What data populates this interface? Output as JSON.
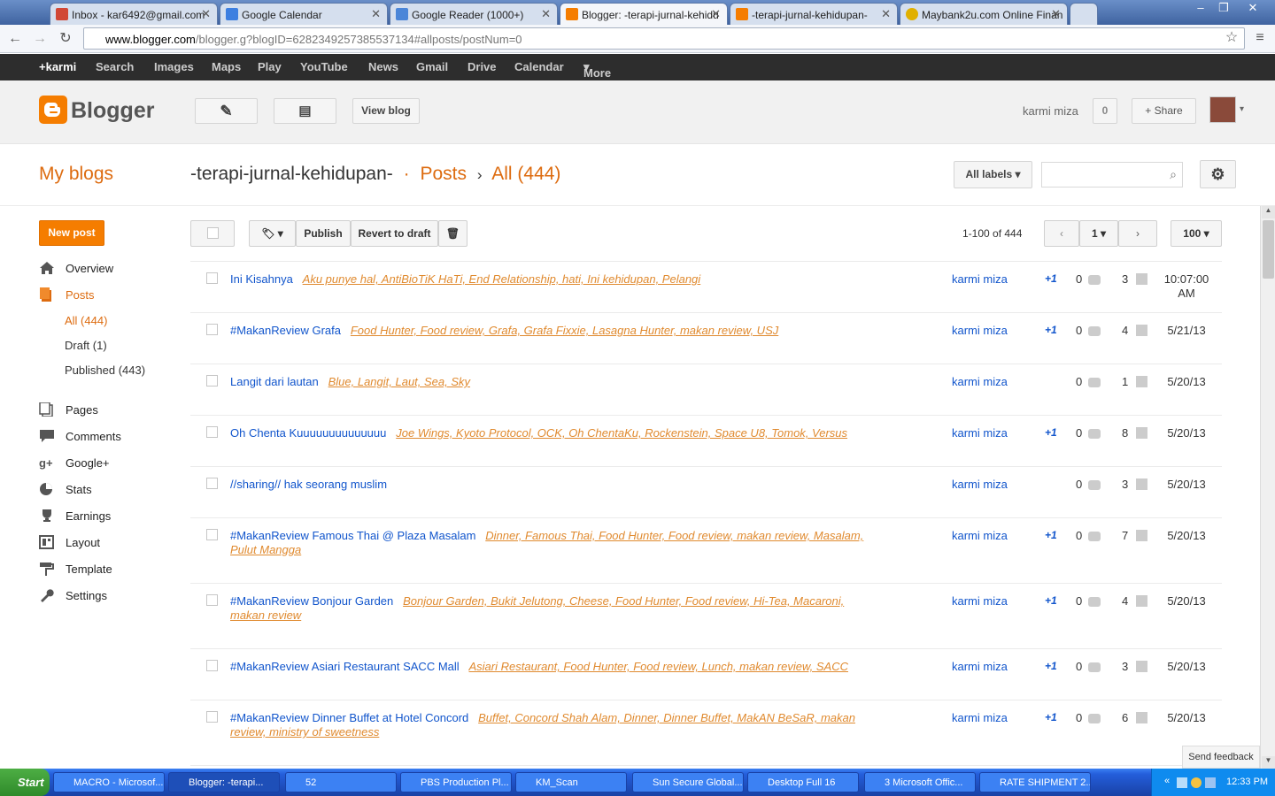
{
  "browser": {
    "tabs": [
      {
        "label": "Inbox - kar6492@gmail.com"
      },
      {
        "label": "Google Calendar"
      },
      {
        "label": "Google Reader (1000+)"
      },
      {
        "label": "Blogger: -terapi-jurnal-kehidu"
      },
      {
        "label": "-terapi-jurnal-kehidupan-"
      },
      {
        "label": "Maybank2u.com Online Finan"
      }
    ],
    "url_host": "www.blogger.com",
    "url_path": "/blogger.g?blogID=6282349257385537134#allposts/postNum=0"
  },
  "gbar": [
    "+karmi",
    "Search",
    "Images",
    "Maps",
    "Play",
    "YouTube",
    "News",
    "Gmail",
    "Drive",
    "Calendar",
    "More"
  ],
  "header": {
    "logo_text": "Blogger",
    "view_blog": "View blog",
    "username": "karmi miza",
    "notif_count": "0",
    "share": "Share"
  },
  "subheader": {
    "my_blogs": "My blogs",
    "blog_name": "-terapi-jurnal-kehidupan-",
    "dot": "·",
    "posts": "Posts",
    "sep": "›",
    "all": "All (444)",
    "labels_dropdown": "All labels"
  },
  "sidebar": {
    "new_post": "New post",
    "items": [
      {
        "label": "Overview"
      },
      {
        "label": "Posts"
      },
      {
        "label": "Pages"
      },
      {
        "label": "Comments"
      },
      {
        "label": "Google+"
      },
      {
        "label": "Stats"
      },
      {
        "label": "Earnings"
      },
      {
        "label": "Layout"
      },
      {
        "label": "Template"
      },
      {
        "label": "Settings"
      }
    ],
    "sub": [
      "All (444)",
      "Draft (1)",
      "Published (443)"
    ]
  },
  "actions": {
    "publish": "Publish",
    "revert": "Revert to draft",
    "range": "1-100 of 444",
    "page": "1",
    "per_page": "100"
  },
  "posts": [
    {
      "title": "Ini Kisahnya",
      "labels": "Aku punye hal, AntiBioTiK HaTi, End Relationship, hati, Ini kehidupan, Pelangi",
      "author": "karmi miza",
      "plus": "+1",
      "comments": "0",
      "views": "3",
      "date": "10:07:00 AM"
    },
    {
      "title": "#MakanReview Grafa",
      "labels": "Food Hunter, Food review, Grafa, Grafa Fixxie, Lasagna Hunter, makan review, USJ",
      "author": "karmi miza",
      "plus": "+1",
      "comments": "0",
      "views": "4",
      "date": "5/21/13"
    },
    {
      "title": "Langit dari lautan",
      "labels": "Blue, Langit, Laut, Sea, Sky",
      "author": "karmi miza",
      "plus": "",
      "comments": "0",
      "views": "1",
      "date": "5/20/13"
    },
    {
      "title": "Oh Chenta Kuuuuuuuuuuuuuu",
      "labels": "Joe Wings, Kyoto Protocol, OCK, Oh ChentaKu, Rockenstein, Space U8, Tomok, Versus",
      "author": "karmi miza",
      "plus": "+1",
      "comments": "0",
      "views": "8",
      "date": "5/20/13"
    },
    {
      "title": "//sharing// hak seorang muslim",
      "labels": "",
      "author": "karmi miza",
      "plus": "",
      "comments": "0",
      "views": "3",
      "date": "5/20/13"
    },
    {
      "title": "#MakanReview Famous Thai @ Plaza Masalam",
      "labels": "Dinner, Famous Thai, Food Hunter, Food review, makan review, Masalam, Pulut Mangga",
      "author": "karmi miza",
      "plus": "+1",
      "comments": "0",
      "views": "7",
      "date": "5/20/13"
    },
    {
      "title": "#MakanReview Bonjour Garden",
      "labels": "Bonjour Garden, Bukit Jelutong, Cheese, Food Hunter, Food review, Hi-Tea, Macaroni, makan review",
      "author": "karmi miza",
      "plus": "+1",
      "comments": "0",
      "views": "4",
      "date": "5/20/13"
    },
    {
      "title": "#MakanReview Asiari Restaurant SACC Mall",
      "labels": "Asiari Restaurant, Food Hunter, Food review, Lunch, makan review, SACC",
      "author": "karmi miza",
      "plus": "+1",
      "comments": "0",
      "views": "3",
      "date": "5/20/13"
    },
    {
      "title": "#MakanReview Dinner Buffet at Hotel Concord",
      "labels": "Buffet, Concord Shah Alam, Dinner, Dinner Buffet, MakAN BeSaR, makan review, ministry of sweetness",
      "author": "karmi miza",
      "plus": "+1",
      "comments": "0",
      "views": "6",
      "date": "5/20/13"
    }
  ],
  "feedback": "Send feedback",
  "taskbar": {
    "start": "Start",
    "items": [
      "MACRO - Microsof...",
      "Blogger: -terapi...",
      "52",
      "PBS Production Pl...",
      "KM_Scan",
      "Sun Secure Global...",
      "Desktop Full 16",
      "3 Microsoft Offic...",
      "RATE SHIPMENT 2..."
    ],
    "clock": "12:33 PM"
  }
}
